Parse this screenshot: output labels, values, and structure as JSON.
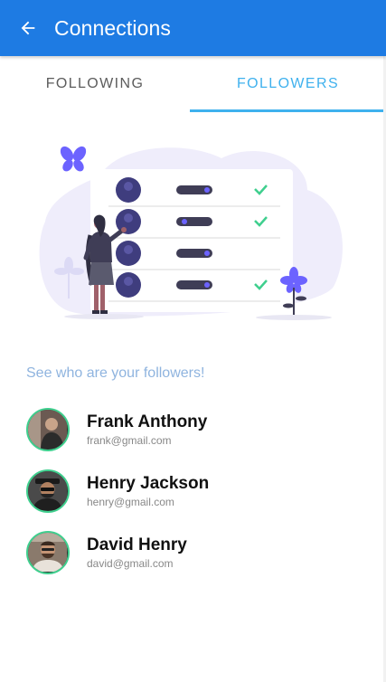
{
  "app_bar": {
    "title": "Connections",
    "back_icon": "arrow-left-icon",
    "color": "#1e7be3"
  },
  "tabs": [
    {
      "label": "FOLLOWING",
      "active": false
    },
    {
      "label": "FOLLOWERS",
      "active": true
    }
  ],
  "accent_color": "#3fb1ee",
  "subtitle": "See who are your followers!",
  "followers": [
    {
      "name": "Frank Anthony",
      "email": "frank@gmail.com"
    },
    {
      "name": "Henry Jackson",
      "email": "henry@gmail.com"
    },
    {
      "name": "David Henry",
      "email": "david@gmail.com"
    }
  ]
}
